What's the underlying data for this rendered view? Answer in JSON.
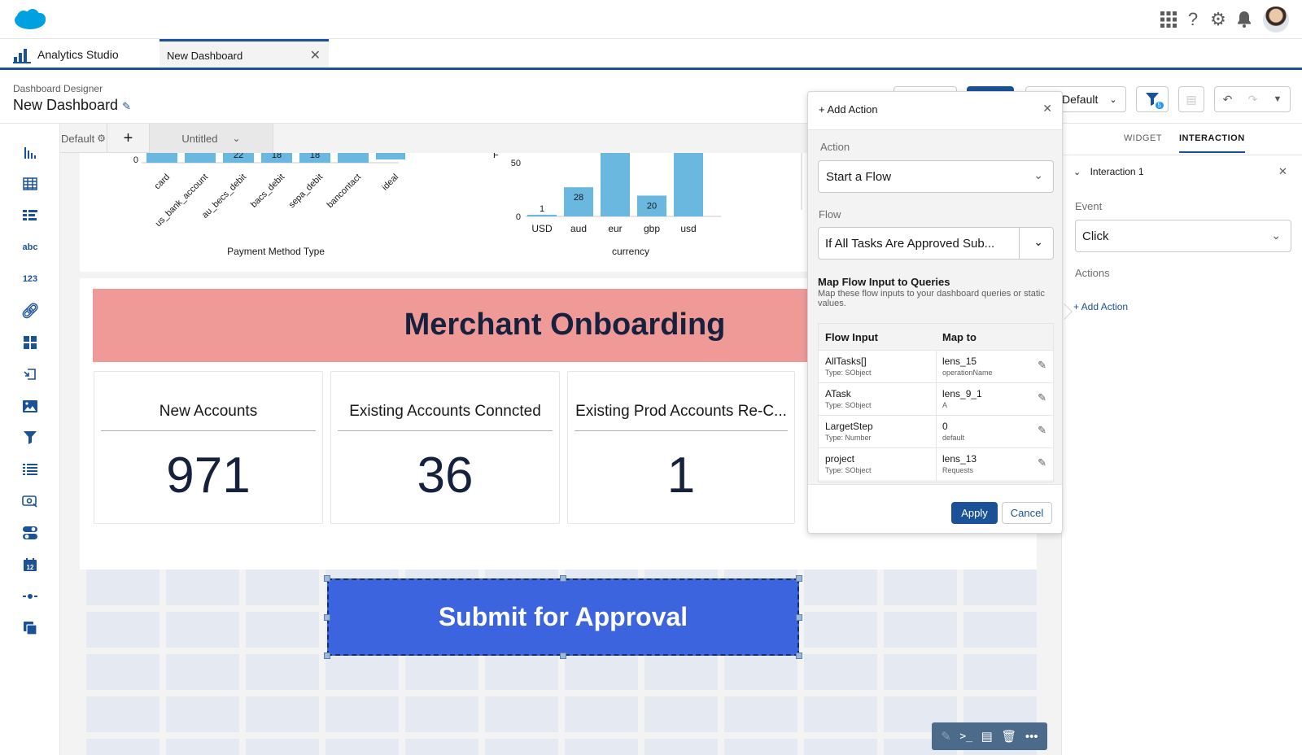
{
  "global": {
    "icons": [
      "app-launcher-icon",
      "help-icon",
      "settings-icon",
      "notification-icon"
    ]
  },
  "app": {
    "name": "Analytics Studio",
    "tab_label": "New Dashboard"
  },
  "designer": {
    "subtitle": "Dashboard Designer",
    "title": "New Dashboard",
    "layout_label": "Default",
    "filter_badge": "5"
  },
  "page_tabs": {
    "default_label": "Default",
    "add_label": "+",
    "untitled_label": "Untitled"
  },
  "charts": {
    "left": {
      "xlabel": "Payment Method Type",
      "ytick": "0",
      "categories": [
        "card",
        "us_bank_account",
        "au_becs_debit",
        "bacs_debit",
        "sepa_debit",
        "bancontact",
        "ideal"
      ],
      "labels": [
        "",
        "",
        "22",
        "18",
        "18",
        "",
        ""
      ]
    },
    "right": {
      "xlabel": "currency",
      "yticks": [
        "50",
        "0"
      ],
      "ylabel_fragment": "F",
      "categories": [
        "USD",
        "aud",
        "eur",
        "gbp",
        "usd"
      ],
      "values": [
        1,
        28,
        120,
        20,
        120
      ],
      "labels": [
        "1",
        "28",
        "",
        "20",
        ""
      ]
    }
  },
  "chart_data": [
    {
      "type": "bar",
      "xlabel": "Payment Method Type",
      "categories": [
        "card",
        "us_bank_account",
        "au_becs_debit",
        "bacs_debit",
        "sepa_debit",
        "bancontact",
        "ideal"
      ],
      "values": [
        null,
        null,
        22,
        18,
        18,
        null,
        null
      ]
    },
    {
      "type": "bar",
      "xlabel": "currency",
      "categories": [
        "USD",
        "aud",
        "eur",
        "gbp",
        "usd"
      ],
      "values": [
        1,
        28,
        null,
        20,
        null
      ],
      "ylim": [
        0,
        50
      ]
    }
  ],
  "banner": {
    "title": "Merchant Onboarding"
  },
  "kpis": [
    {
      "title": "New Accounts",
      "value": "971"
    },
    {
      "title": "Existing Accounts Conncted",
      "value": "36"
    },
    {
      "title": "Existing Prod Accounts Re-C...",
      "value": "1"
    }
  ],
  "submit_button": {
    "label": "Submit for Approval"
  },
  "right_panel": {
    "tab_widget": "WIDGET",
    "tab_interaction": "INTERACTION",
    "interaction_title": "Interaction 1",
    "event_label": "Event",
    "event_value": "Click",
    "actions_label": "Actions",
    "add_action": "+ Add Action"
  },
  "popover": {
    "title": "+ Add Action",
    "action_label": "Action",
    "action_value": "Start a Flow",
    "flow_label": "Flow",
    "flow_value": "If All Tasks Are Approved Sub...",
    "map_title": "Map Flow Input to Queries",
    "map_desc": "Map these flow inputs to your dashboard queries or static values.",
    "col_input": "Flow Input",
    "col_map": "Map to",
    "rows": [
      {
        "input": "AllTasks[]",
        "type": "Type: SObject",
        "map": "lens_15",
        "sub": "operationName"
      },
      {
        "input": "ATask",
        "type": "Type: SObject",
        "map": "lens_9_1",
        "sub": "A"
      },
      {
        "input": "LargetStep",
        "type": "Type: Number",
        "map": "0",
        "sub": "default"
      },
      {
        "input": "project",
        "type": "Type: SObject",
        "map": "lens_13",
        "sub": "Requests"
      }
    ],
    "apply_label": "Apply",
    "cancel_label": "Cancel"
  }
}
